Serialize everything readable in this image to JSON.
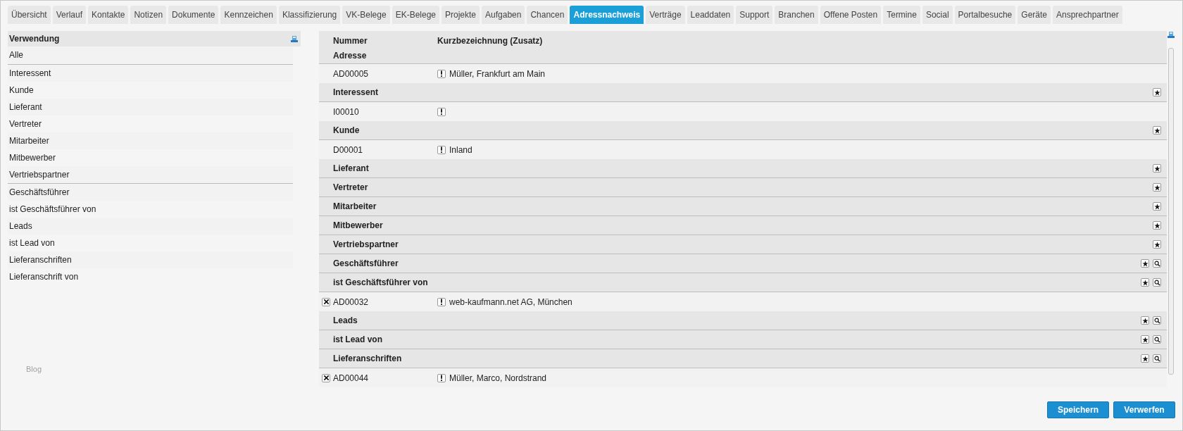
{
  "tabs": [
    {
      "label": "Übersicht",
      "selected": false
    },
    {
      "label": "Verlauf",
      "selected": false
    },
    {
      "label": "Kontakte",
      "selected": false
    },
    {
      "label": "Notizen",
      "selected": false
    },
    {
      "label": "Dokumente",
      "selected": false
    },
    {
      "label": "Kennzeichen",
      "selected": false
    },
    {
      "label": "Klassifizierung",
      "selected": false
    },
    {
      "label": "VK-Belege",
      "selected": false
    },
    {
      "label": "EK-Belege",
      "selected": false
    },
    {
      "label": "Projekte",
      "selected": false
    },
    {
      "label": "Aufgaben",
      "selected": false
    },
    {
      "label": "Chancen",
      "selected": false
    },
    {
      "label": "Adressnachweis",
      "selected": true
    },
    {
      "label": "Verträge",
      "selected": false
    },
    {
      "label": "Leaddaten",
      "selected": false
    },
    {
      "label": "Support",
      "selected": false
    },
    {
      "label": "Branchen",
      "selected": false
    },
    {
      "label": "Offene Posten",
      "selected": false
    },
    {
      "label": "Termine",
      "selected": false
    },
    {
      "label": "Social",
      "selected": false
    },
    {
      "label": "Portalbesuche",
      "selected": false
    },
    {
      "label": "Geräte",
      "selected": false
    },
    {
      "label": "Ansprechpartner",
      "selected": false
    }
  ],
  "usage_list": {
    "header": "Verwendung",
    "sections": [
      {
        "items": [
          "Alle"
        ]
      },
      {
        "items": [
          "Interessent",
          "Kunde",
          "Lieferant",
          "Vertreter",
          "Mitarbeiter",
          "Mitbewerber",
          "Vertriebspartner"
        ]
      },
      {
        "items": [
          "Geschäftsführer",
          "ist Geschäftsführer von",
          "Leads",
          "ist Lead von",
          "Lieferanschriften",
          "Lieferanschrift von"
        ]
      }
    ]
  },
  "footer_link": "Blog",
  "address_table": {
    "columns": [
      "Nummer",
      "Kurzbezeichnung (Zusatz)"
    ],
    "groups": [
      {
        "label": "Adresse",
        "star": false,
        "search": false,
        "entries": [
          {
            "number": "AD00005",
            "removable": false,
            "flag": true,
            "text": "Müller, Frankfurt am Main"
          }
        ]
      },
      {
        "label": "Interessent",
        "star": true,
        "search": false,
        "entries": [
          {
            "number": "I00010",
            "removable": false,
            "flag": true
          }
        ]
      },
      {
        "label": "Kunde",
        "star": true,
        "search": false,
        "entries": [
          {
            "number": "D00001",
            "removable": false,
            "flag": true,
            "text": "Inland"
          }
        ]
      },
      {
        "label": "Lieferant",
        "star": true,
        "search": false
      },
      {
        "label": "Vertreter",
        "star": true,
        "search": false
      },
      {
        "label": "Mitarbeiter",
        "star": true,
        "search": false
      },
      {
        "label": "Mitbewerber",
        "star": true,
        "search": false
      },
      {
        "label": "Vertriebspartner",
        "star": true,
        "search": false
      },
      {
        "label": "Geschäftsführer",
        "star": true,
        "search": true
      },
      {
        "label": "ist Geschäftsführer von",
        "star": true,
        "search": true,
        "entries": [
          {
            "number": "AD00032",
            "removable": true,
            "flag": true,
            "text": "web-kaufmann.net AG, München"
          }
        ]
      },
      {
        "label": "Leads",
        "star": true,
        "search": true
      },
      {
        "label": "ist Lead von",
        "star": true,
        "search": true
      },
      {
        "label": "Lieferanschriften",
        "star": true,
        "search": true,
        "entries": [
          {
            "number": "AD00044",
            "removable": true,
            "flag": true,
            "text": "Müller, Marco, Nordstrand"
          }
        ]
      }
    ]
  },
  "buttons": [
    "Speichern",
    "Verwerfen"
  ]
}
